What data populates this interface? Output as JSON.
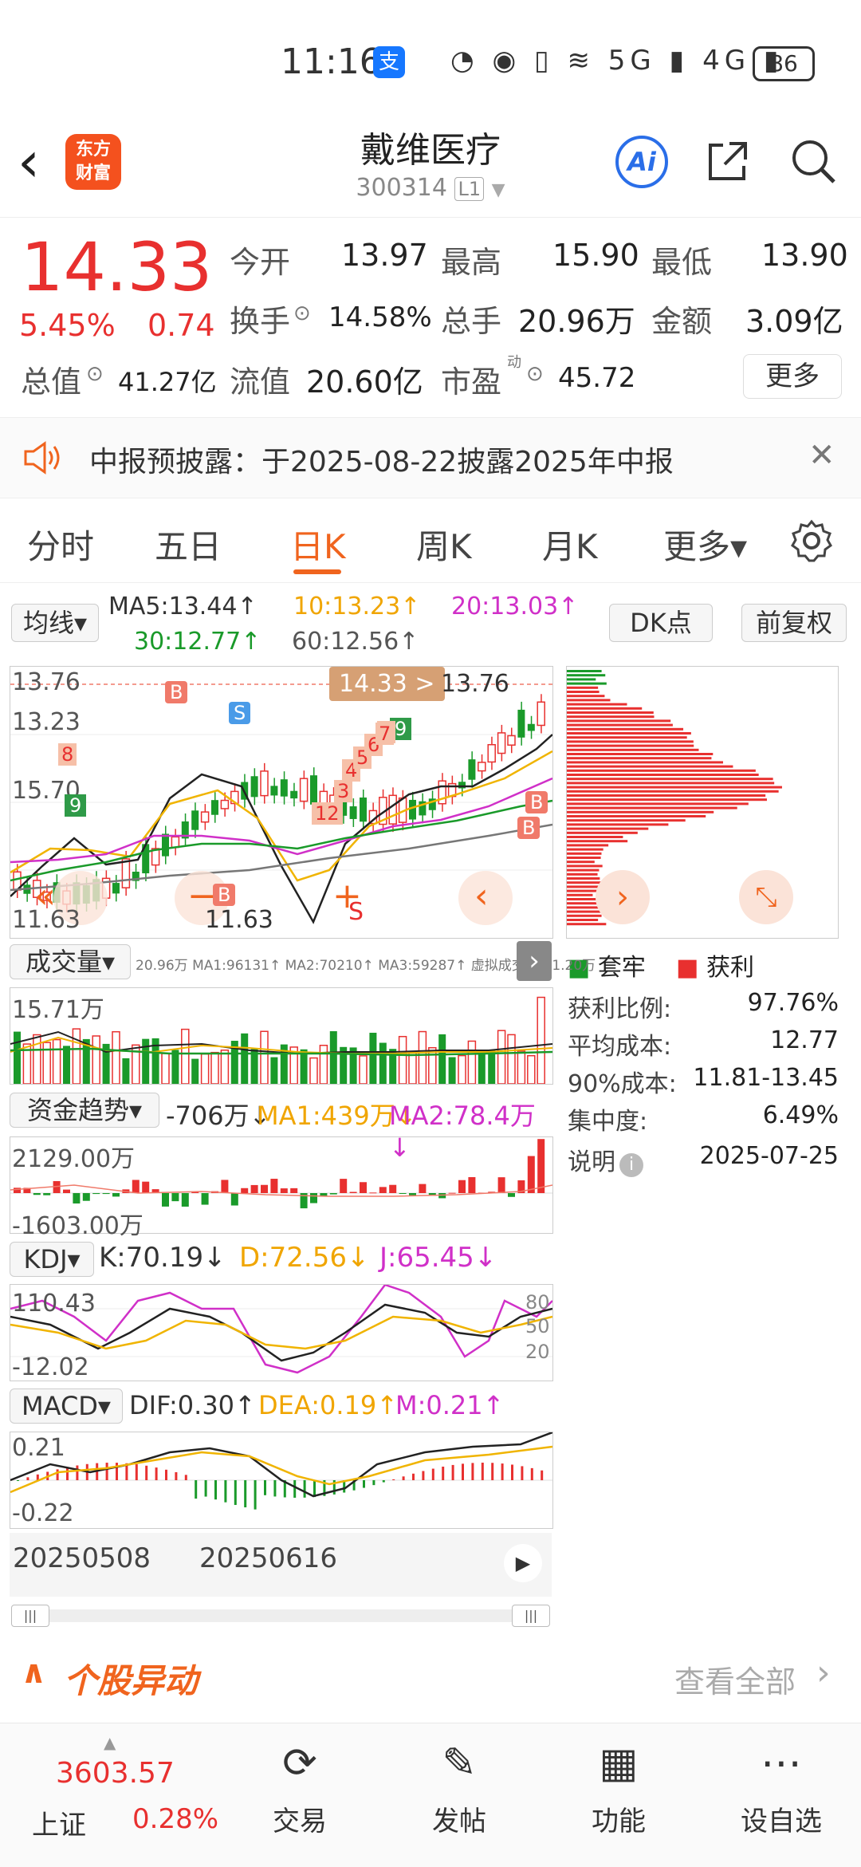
{
  "status": {
    "time": "11:16",
    "alipay": "支",
    "icons": "◔ ◉ ▯ ≋ 5G ▮ 4G ▮",
    "battery": "86"
  },
  "header": {
    "logo_line1": "东方",
    "logo_line2": "财富",
    "name": "戴维医疗",
    "code": "300314",
    "market": "L1",
    "ai": "Ai"
  },
  "quote": {
    "price": "14.33",
    "pct": "5.45%",
    "change": "0.74",
    "open_label": "今开",
    "open": "13.97",
    "high_label": "最高",
    "high": "15.90",
    "low_label": "最低",
    "low": "13.90",
    "turnover_label": "换手",
    "turnover": "14.58%",
    "volume_label": "总手",
    "volume": "20.96万",
    "amount_label": "金额",
    "amount": "3.09亿",
    "mktcap_label": "总值",
    "mktcap": "41.27亿",
    "float_label": "流值",
    "float": "20.60亿",
    "pe_label": "市盈",
    "pe_sup": "动",
    "pe": "45.72",
    "more": "更多"
  },
  "notice": {
    "text": "中报预披露：于2025-08-22披露2025年中报",
    "close": "✕"
  },
  "tabs": [
    "分时",
    "五日",
    "日K",
    "周K",
    "月K",
    "更多▾"
  ],
  "ma": {
    "selector": "均线▾",
    "ma5": "MA5:13.44↑",
    "ma10": "10:13.23↑",
    "ma20": "20:13.03↑",
    "ma30": "30:12.77↑",
    "ma60": "60:12.56↑",
    "dk": "DK点",
    "fq": "前复权"
  },
  "kchart": {
    "top_label": "13.76",
    "mid_label": "13.23",
    "low_label": "11.63",
    "left_label": "15.70",
    "price_tag": "14.33 >",
    "high_tag": "13.76",
    "low_tag": "11.63",
    "markers": [
      "B",
      "S",
      "B",
      "B",
      "B",
      "S",
      "9",
      "9",
      "8",
      "8",
      "12",
      "3",
      "4",
      "5",
      "6",
      "7"
    ]
  },
  "volume": {
    "selector": "成交量▾",
    "info": "20.96万 MA1:96131↑ MA2:70210↑ MA3:59287↑ 虚拟成交量:31.20万",
    "top": "15.71万"
  },
  "fund": {
    "selector": "资金趋势▾",
    "val": "-706万↓",
    "ma1": "MA1:439万↓",
    "ma2": "MA2:78.4万↓",
    "top": "2129.00万",
    "bottom": "-1603.00万"
  },
  "kdj": {
    "selector": "KDJ▾",
    "k": "K:70.19↓",
    "d": "D:72.56↓",
    "j": "J:65.45↓",
    "top": "110.43",
    "bottom": "-12.02",
    "r1": "80",
    "r2": "50",
    "r3": "20"
  },
  "macd": {
    "selector": "MACD▾",
    "dif": "DIF:0.30↑",
    "dea": "DEA:0.19↑",
    "m": "M:0.21↑",
    "top": "0.21",
    "bottom": "-0.22"
  },
  "dates": {
    "d1": "20250508",
    "d2": "20250616"
  },
  "chips": {
    "legend_trap": "套牢",
    "legend_profit": "获利",
    "rows": [
      {
        "label": "获利比例:",
        "value": "97.76%"
      },
      {
        "label": "平均成本:",
        "value": "12.77"
      },
      {
        "label": "90%成本:",
        "value": "11.81-13.45"
      },
      {
        "label": "集中度:",
        "value": "6.49%"
      }
    ],
    "note": "说明",
    "date": "2025-07-25"
  },
  "section": {
    "title": "个股异动",
    "more": "查看全部"
  },
  "nav": {
    "index_value": "3603.57",
    "index_name": "上证",
    "index_pct": "0.28%",
    "items": [
      "交易",
      "发帖",
      "功能",
      "设自选"
    ]
  },
  "colors": {
    "up": "#e8302f",
    "down": "#1a9a2a",
    "accent": "#f0641e",
    "ma10": "#f0b400",
    "ma20": "#d030c8"
  }
}
